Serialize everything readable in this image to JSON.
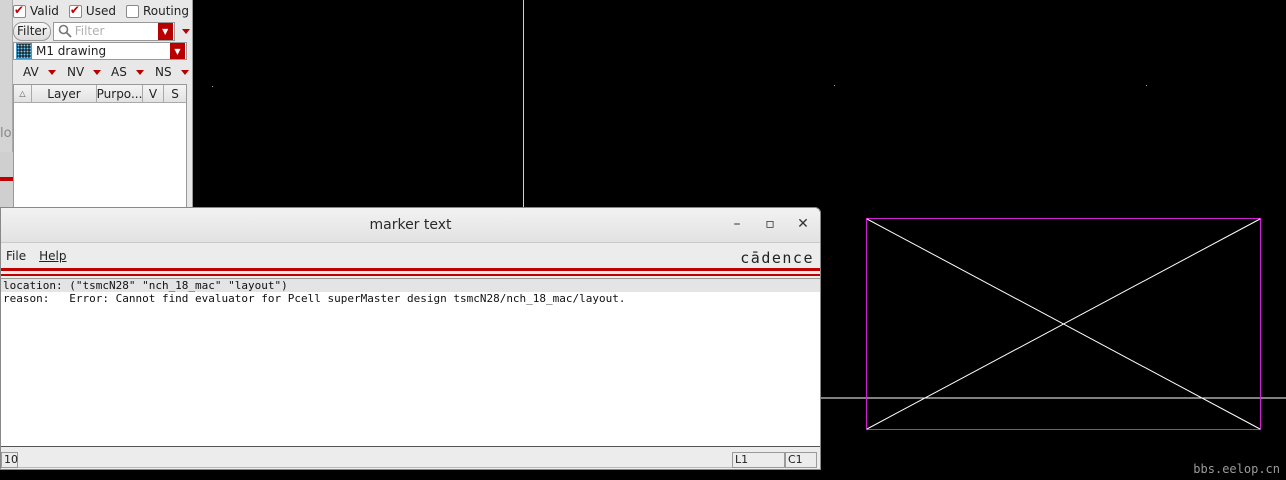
{
  "palette": {
    "valid_label": "Valid",
    "used_label": "Used",
    "routing_label": "Routing",
    "valid_checked": true,
    "used_checked": true,
    "routing_checked": false,
    "filter_button": "Filter",
    "filter_placeholder": "Filter",
    "current_layer": "M1 drawing",
    "visibility_buttons": [
      "AV",
      "NV",
      "AS",
      "NS"
    ],
    "table_columns": [
      "Layer",
      "Purpo...",
      "V",
      "S"
    ],
    "ghost_text": "lo"
  },
  "dialog": {
    "title": "marker text",
    "menu": [
      "File",
      "Help"
    ],
    "brand": "cādence",
    "lines": [
      "location: (\"tsmcN28\" \"nch_18_mac\" \"layout\")",
      "reason:   Error: Cannot find evaluator for Pcell superMaster design tsmcN28/nch_18_mac/layout."
    ],
    "status_left": "10",
    "status_line": "L1",
    "status_col": "C1"
  },
  "colors": {
    "cell_boundary": "#d020d0",
    "cross": "#ffffff",
    "accent_red": "#c00000"
  },
  "watermark": "bbs.eelop.cn"
}
